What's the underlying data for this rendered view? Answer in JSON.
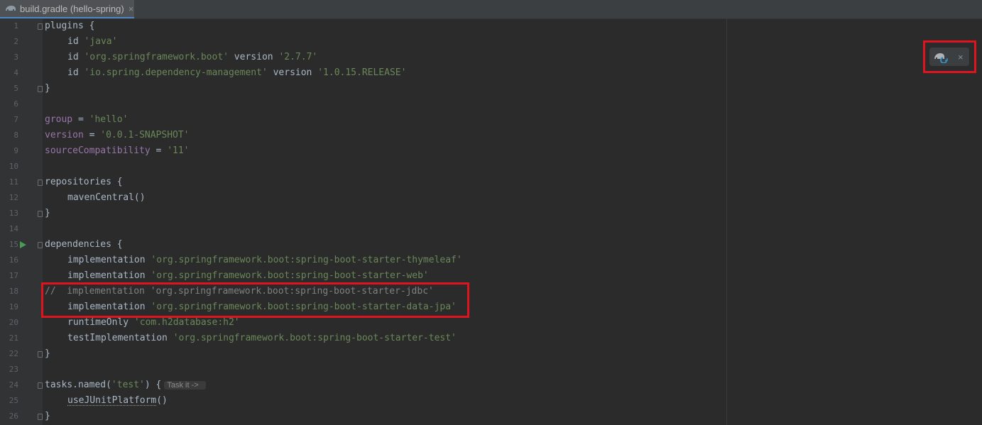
{
  "tab": {
    "label": "build.gradle (hello-spring)",
    "close": "×"
  },
  "line_numbers": [
    "1",
    "2",
    "3",
    "4",
    "5",
    "6",
    "7",
    "8",
    "9",
    "10",
    "11",
    "12",
    "13",
    "14",
    "15",
    "16",
    "17",
    "18",
    "19",
    "20",
    "21",
    "22",
    "23",
    "24",
    "25",
    "26"
  ],
  "code": {
    "l1": "plugins {",
    "l2_kw": "id ",
    "l2_s": "'java'",
    "l3_kw": "id ",
    "l3_s1": "'org.springframework.boot'",
    "l3_kw2": " version ",
    "l3_s2": "'2.7.7'",
    "l4_kw": "id ",
    "l4_s1": "'io.spring.dependency-management'",
    "l4_kw2": " version ",
    "l4_s2": "'1.0.15.RELEASE'",
    "l5": "}",
    "l7_p": "group",
    "l7_eq": " = ",
    "l7_s": "'hello'",
    "l8_p": "version",
    "l8_eq": " = ",
    "l8_s": "'0.0.1-SNAPSHOT'",
    "l9_p": "sourceCompatibility",
    "l9_eq": " = ",
    "l9_s": "'11'",
    "l11": "repositories {",
    "l12": "mavenCentral()",
    "l13": "}",
    "l15": "dependencies {",
    "l16_kw": "implementation ",
    "l16_s": "'org.springframework.boot:spring-boot-starter-thymeleaf'",
    "l17_kw": "implementation ",
    "l17_s": "'org.springframework.boot:spring-boot-starter-web'",
    "l18": "//  implementation 'org.springframework.boot:spring-boot-starter-jdbc'",
    "l19_kw": "implementation ",
    "l19_s": "'org.springframework.boot:spring-boot-starter-data-jpa'",
    "l20_kw": "runtimeOnly ",
    "l20_s": "'com.h2database:h2'",
    "l21_kw": "testImplementation ",
    "l21_s": "'org.springframework.boot:spring-boot-starter-test'",
    "l22": "}",
    "l24_a": "tasks.named(",
    "l24_s": "'test'",
    "l24_b": ") {",
    "l24_hint": "Task it ->",
    "l25_m": "useJUnitPlatform",
    "l25_b": "()",
    "l26": "}"
  },
  "floating_toolbar": {
    "close": "×",
    "icon": "gradle-reload-icon"
  },
  "colors": {
    "background": "#2b2b2b",
    "string": "#6a8759",
    "property": "#9876aa",
    "comment": "#808080",
    "highlight": "#e0141e"
  }
}
